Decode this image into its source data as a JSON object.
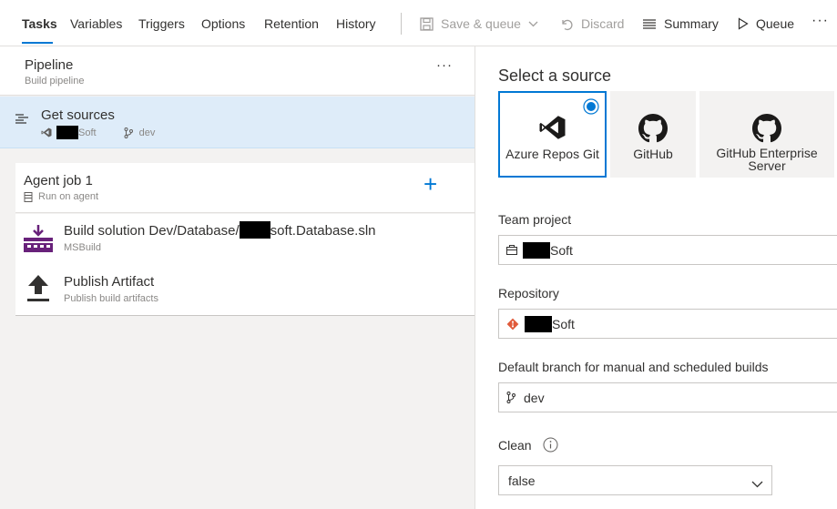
{
  "tabs": [
    {
      "label": "Tasks"
    },
    {
      "label": "Variables"
    },
    {
      "label": "Triggers"
    },
    {
      "label": "Options"
    },
    {
      "label": "Retention"
    },
    {
      "label": "History"
    }
  ],
  "commands": {
    "save_queue": "Save & queue",
    "discard": "Discard",
    "summary": "Summary",
    "queue": "Queue",
    "more": "···"
  },
  "pipeline": {
    "title": "Pipeline",
    "subtitle": "Build pipeline",
    "more": "···"
  },
  "get_sources": {
    "title": "Get sources",
    "repo_suffix": "Soft",
    "branch": "dev"
  },
  "agent_job": {
    "title": "Agent job 1",
    "subtitle": "Run on agent",
    "add": "+"
  },
  "tasks": [
    {
      "title_prefix": "Build solution Dev/Database/",
      "title_suffix": "soft.Database.sln",
      "subtitle": "MSBuild"
    },
    {
      "title": "Publish Artifact",
      "subtitle": "Publish build artifacts"
    }
  ],
  "source_panel": {
    "heading": "Select a source",
    "sources": [
      {
        "label": "Azure Repos Git",
        "icon": "visual-studio-icon",
        "selected": true
      },
      {
        "label": "GitHub",
        "icon": "github-icon",
        "selected": false
      },
      {
        "label_line1": "GitHub Enterprise",
        "label_line2": "Server",
        "icon": "github-icon",
        "selected": false
      }
    ]
  },
  "form": {
    "team_project_label": "Team project",
    "team_project_suffix": "Soft",
    "repository_label": "Repository",
    "repository_suffix": "Soft",
    "branch_label": "Default branch for manual and scheduled builds",
    "branch_value": "dev",
    "clean_label": "Clean",
    "clean_value": "false"
  },
  "colors": {
    "accent": "#0078d4",
    "selected_row": "#deecf9",
    "git_red": "#e05a3a",
    "msbuild_purple": "#68217a"
  }
}
